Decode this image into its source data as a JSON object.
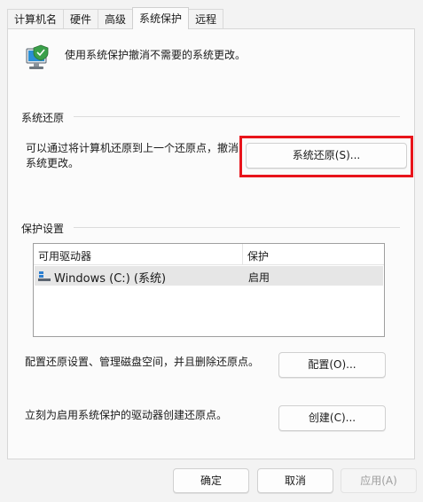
{
  "tabs": [
    {
      "label": "计算机名"
    },
    {
      "label": "硬件"
    },
    {
      "label": "高级"
    },
    {
      "label": "系统保护",
      "active": true
    },
    {
      "label": "远程"
    }
  ],
  "intro": {
    "text": "使用系统保护撤消不需要的系统更改。",
    "icon": "computer-shield-icon"
  },
  "restore": {
    "group_title": "系统还原",
    "desc_line1": "可以通过将计算机还原到上一个还原点，撤消",
    "desc_line2": "系统更改。",
    "button_label": "系统还原(S)...",
    "highlight_color": "#e8141b"
  },
  "protection": {
    "group_title": "保护设置",
    "columns": [
      "可用驱动器",
      "保护"
    ],
    "drives": [
      {
        "name": "Windows  (C:) (系统)",
        "status": "启用",
        "icon": "drive-icon"
      }
    ],
    "config_text": "配置还原设置、管理磁盘空间，并且删除还原点。",
    "config_button": "配置(O)...",
    "create_text": "立刻为启用系统保护的驱动器创建还原点。",
    "create_button": "创建(C)..."
  },
  "footer": {
    "ok": "确定",
    "cancel": "取消",
    "apply": "应用(A)"
  }
}
